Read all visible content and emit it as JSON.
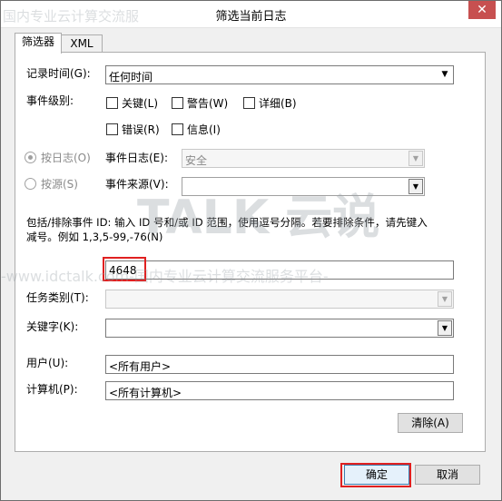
{
  "dialog": {
    "title": "筛选当前日志",
    "close_glyph": "✕"
  },
  "tabs": [
    {
      "label": "筛选器"
    },
    {
      "label": "XML"
    }
  ],
  "filter": {
    "logged_label": "记录时间(G):",
    "logged_value": "任何时间",
    "level_label": "事件级别:",
    "levels": [
      "关键(L)",
      "警告(W)",
      "详细(B)",
      "错误(R)",
      "信息(I)"
    ],
    "by_log_label": "按日志(O)",
    "event_logs_label": "事件日志(E):",
    "event_logs_value": "安全",
    "by_source_label": "按源(S)",
    "event_sources_label": "事件来源(V):",
    "event_sources_value": "",
    "include_hint_line1": "包括/排除事件 ID: 输入 ID 号和/或 ID 范围，使用逗号分隔。若要排除条件，请先键入",
    "include_hint_line2": "减号。例如 1,3,5-99,-76(N)",
    "event_id_value": "4648",
    "task_category_label": "任务类别(T):",
    "keywords_label": "关键字(K):",
    "user_label": "用户(U):",
    "user_value": "<所有用户>",
    "computer_label": "计算机(P):",
    "computer_value": "<所有计算机>",
    "clear_label": "清除(A)"
  },
  "footer": {
    "ok_label": "确定",
    "cancel_label": "取消"
  },
  "watermark": {
    "top_text": "国内专业云计算交流服",
    "brand_text": "TALK 云说",
    "url_text": "-www.idctalk.com-国内专业云计算交流服务平台-"
  }
}
